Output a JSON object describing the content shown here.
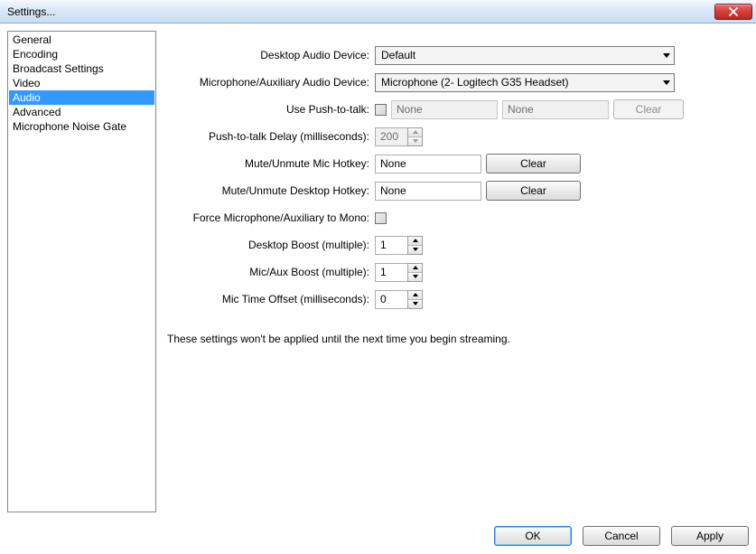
{
  "window": {
    "title": "Settings..."
  },
  "nav": {
    "items": [
      {
        "label": "General"
      },
      {
        "label": "Encoding"
      },
      {
        "label": "Broadcast Settings"
      },
      {
        "label": "Video"
      },
      {
        "label": "Audio",
        "selected": true
      },
      {
        "label": "Advanced"
      },
      {
        "label": "Microphone Noise Gate"
      }
    ]
  },
  "labels": {
    "desktop_audio_device": "Desktop Audio Device:",
    "mic_aux_device": "Microphone/Auxiliary Audio Device:",
    "use_ptt": "Use Push-to-talk:",
    "ptt_delay": "Push-to-talk Delay (milliseconds):",
    "mute_mic_hotkey": "Mute/Unmute Mic Hotkey:",
    "mute_desktop_hotkey": "Mute/Unmute Desktop Hotkey:",
    "force_mono": "Force Microphone/Auxiliary to Mono:",
    "desktop_boost": "Desktop Boost (multiple):",
    "mic_aux_boost": "Mic/Aux Boost (multiple):",
    "mic_time_offset": "Mic Time Offset (milliseconds):"
  },
  "values": {
    "desktop_audio_device": "Default",
    "mic_aux_device": "Microphone (2- Logitech G35 Headset)",
    "ptt_hotkey1": "None",
    "ptt_hotkey2": "None",
    "ptt_delay": "200",
    "mute_mic_hotkey": "None",
    "mute_desktop_hotkey": "None",
    "desktop_boost": "1",
    "mic_aux_boost": "1",
    "mic_time_offset": "0"
  },
  "buttons": {
    "clear": "Clear",
    "ok": "OK",
    "cancel": "Cancel",
    "apply": "Apply"
  },
  "note": "These settings won't be applied until the next time you begin streaming."
}
